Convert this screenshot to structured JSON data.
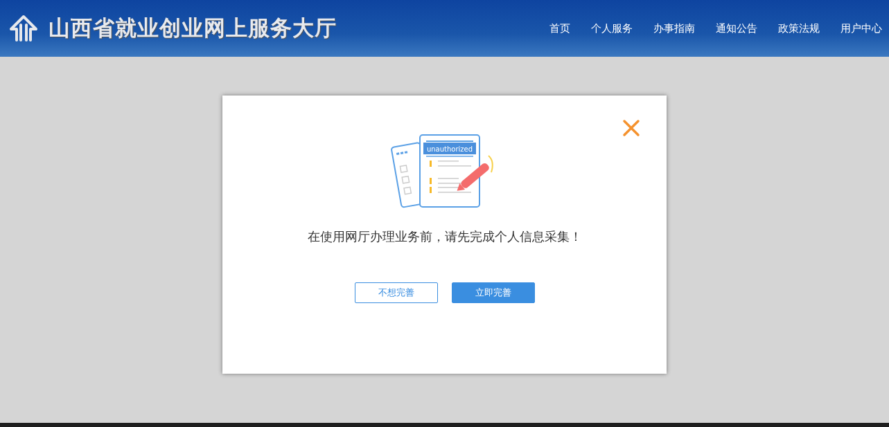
{
  "header": {
    "title": "山西省就业创业网上服务大厅",
    "nav": [
      "首页",
      "个人服务",
      "办事指南",
      "通知公告",
      "政策法规",
      "用户中心"
    ]
  },
  "dialog": {
    "illustration_label": "unauthorized",
    "message": "在使用网厅办理业务前，请先完成个人信息采集！",
    "buttons": [
      {
        "label": "不想完善",
        "kind": "secondary"
      },
      {
        "label": "立即完善",
        "kind": "primary"
      }
    ]
  }
}
